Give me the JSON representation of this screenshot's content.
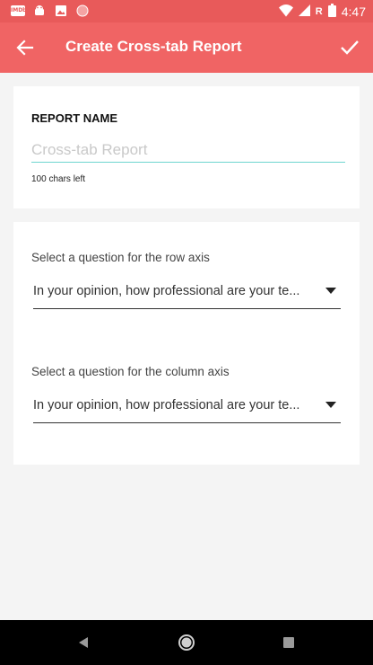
{
  "status_bar": {
    "time": "4:47",
    "carrier_letter": "R",
    "notification_icons": [
      "imdb-icon",
      "android-icon",
      "image-icon",
      "circle-icon"
    ],
    "imdb_text": "IMDb",
    "status_icons": [
      "wifi-icon",
      "signal-icon",
      "battery-icon"
    ]
  },
  "app_bar": {
    "title": "Create Cross-tab Report",
    "back_icon": "arrow-back-icon",
    "confirm_icon": "check-icon",
    "color": "#f06464",
    "status_color": "#e85a5a"
  },
  "report_name": {
    "label": "REPORT NAME",
    "value": "",
    "placeholder": "Cross-tab Report",
    "chars_left": "100 chars left",
    "accent": "#6fd6cf"
  },
  "axes": {
    "row_label": "Select a question for the row axis",
    "row_value": "In your opinion, how professional are your te...",
    "column_label": "Select a question for the column axis",
    "column_value": "In your opinion, how professional are your te..."
  },
  "nav_bar": {
    "buttons": [
      "nav-back-icon",
      "nav-home-icon",
      "nav-recents-icon"
    ]
  }
}
